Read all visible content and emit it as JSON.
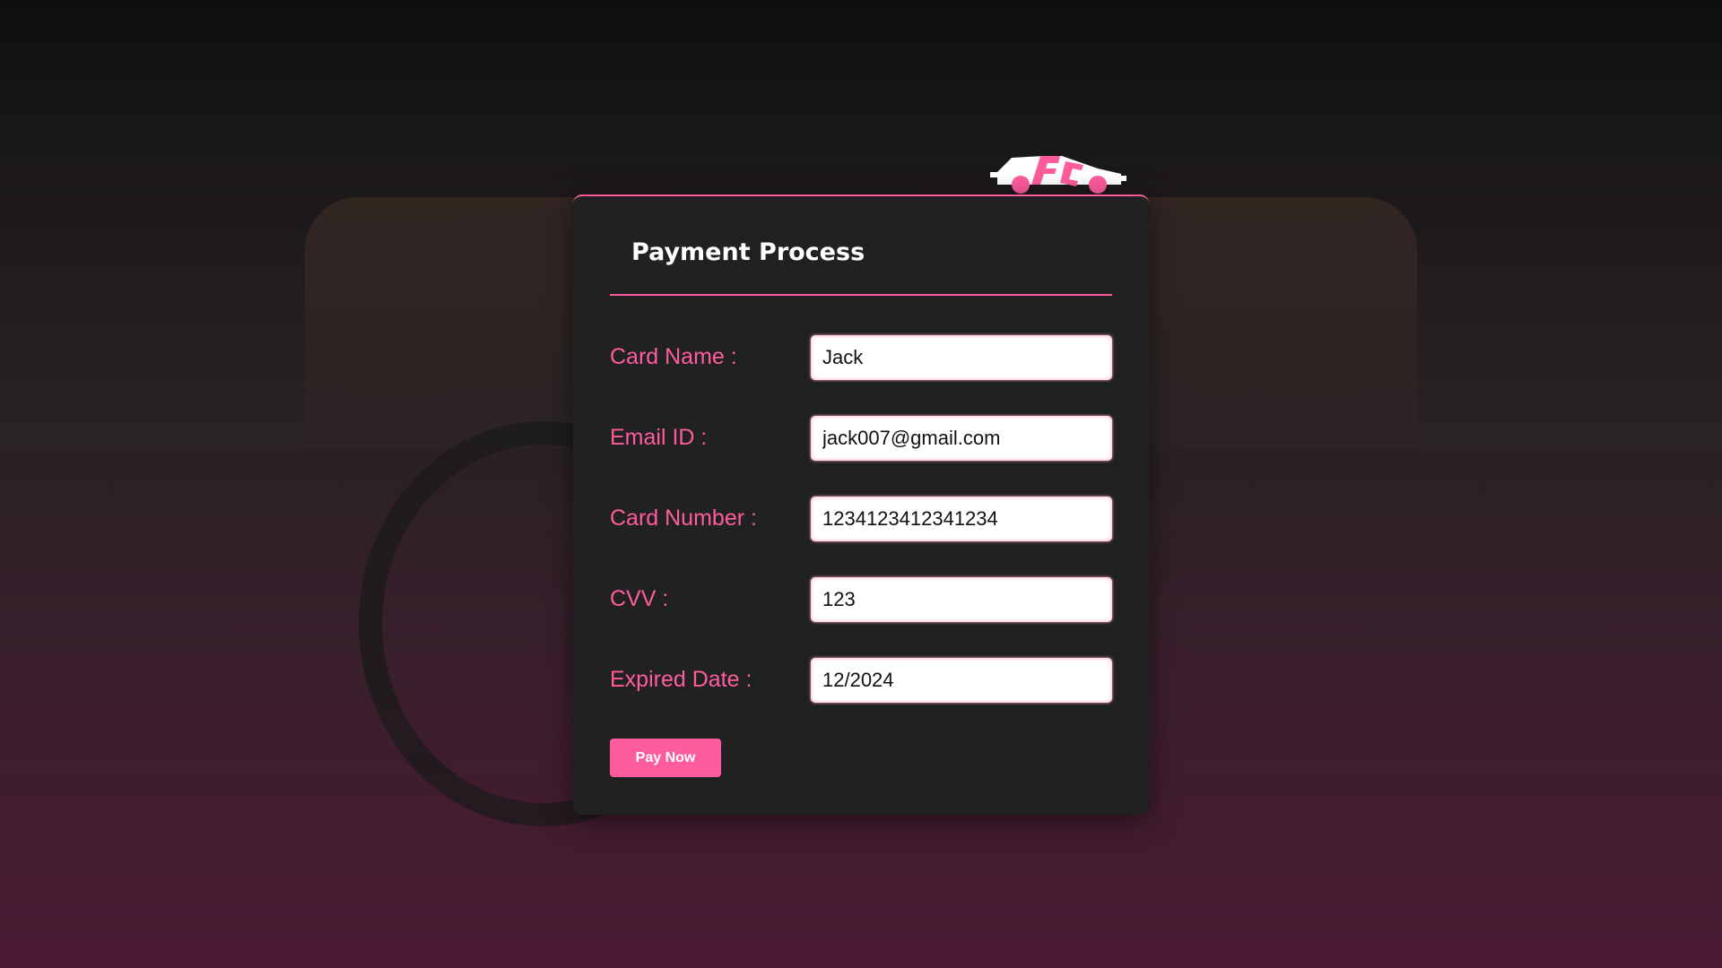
{
  "logo": {
    "text": "FC",
    "accent": "#ff5c9d"
  },
  "title": "Payment Process",
  "fields": [
    {
      "label": "Card Name :",
      "value": "Jack"
    },
    {
      "label": "Email ID :",
      "value": "jack007@gmail.com"
    },
    {
      "label": "Card Number :",
      "value": "1234123412341234"
    },
    {
      "label": "CVV :",
      "value": "123"
    },
    {
      "label": "Expired Date :",
      "value": "12/2024"
    }
  ],
  "pay_button": "Pay Now",
  "colors": {
    "accent": "#ff5c9d",
    "card": "#212121"
  }
}
